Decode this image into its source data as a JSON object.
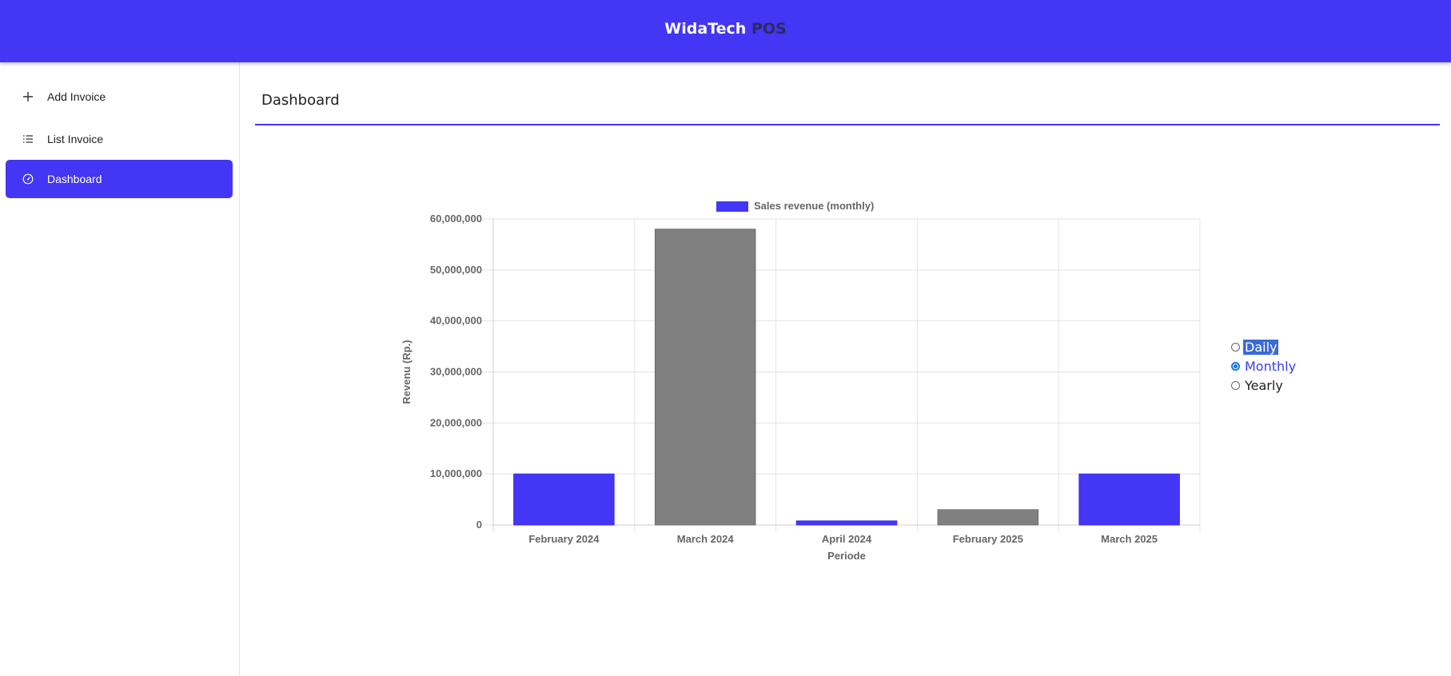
{
  "header": {
    "brand_main": "WidaTech",
    "brand_accent": "POS"
  },
  "sidebar": {
    "items": [
      {
        "label": "Add Invoice",
        "icon": "plus-icon"
      },
      {
        "label": "List Invoice",
        "icon": "list-icon"
      },
      {
        "label": "Dashboard",
        "icon": "gauge-icon",
        "active": true
      }
    ]
  },
  "main": {
    "title": "Dashboard"
  },
  "period_options": {
    "daily": "Daily",
    "monthly": "Monthly",
    "yearly": "Yearly",
    "selected": "Monthly"
  },
  "colors": {
    "accent": "#4336f4",
    "secondary_bar": "#808080"
  },
  "chart_data": {
    "type": "bar",
    "categories": [
      "February 2024",
      "March 2024",
      "April 2024",
      "February 2025",
      "March 2025"
    ],
    "series": [
      {
        "name": "Sales revenue (monthly)",
        "values": [
          10000000,
          58000000,
          800000,
          3000000,
          10000000
        ]
      }
    ],
    "bar_colors": [
      "#4336f4",
      "#808080",
      "#4336f4",
      "#808080",
      "#4336f4"
    ],
    "xlabel": "Periode",
    "ylabel": "Revenu (Rp.)",
    "ylim": [
      0,
      60000000
    ],
    "yticks": [
      "0",
      "10,000,000",
      "20,000,000",
      "30,000,000",
      "40,000,000",
      "50,000,000",
      "60,000,000"
    ],
    "grid": true,
    "legend": "top"
  }
}
